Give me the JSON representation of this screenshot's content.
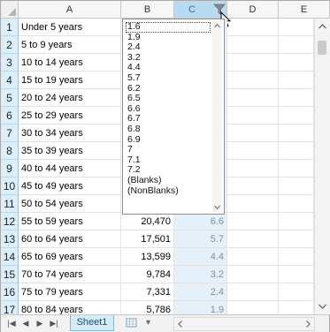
{
  "columns": [
    {
      "label": "A",
      "name": "col-header-a"
    },
    {
      "label": "B",
      "name": "col-header-b"
    },
    {
      "label": "C",
      "name": "col-header-c"
    },
    {
      "label": "D",
      "name": "col-header-d"
    },
    {
      "label": "E",
      "name": "col-header-e"
    }
  ],
  "rows": [
    {
      "num": "1",
      "a": "Under 5 years",
      "b": "",
      "c": ""
    },
    {
      "num": "2",
      "a": "5 to 9 years",
      "b": "",
      "c": ""
    },
    {
      "num": "3",
      "a": "10 to 14 years",
      "b": "",
      "c": ""
    },
    {
      "num": "4",
      "a": "15 to 19 years",
      "b": "",
      "c": ""
    },
    {
      "num": "5",
      "a": "20 to 24 years",
      "b": "",
      "c": ""
    },
    {
      "num": "6",
      "a": "25 to 29 years",
      "b": "",
      "c": ""
    },
    {
      "num": "7",
      "a": "30 to 34 years",
      "b": "",
      "c": ""
    },
    {
      "num": "8",
      "a": "35 to 39 years",
      "b": "",
      "c": ""
    },
    {
      "num": "9",
      "a": "40 to 44 years",
      "b": "",
      "c": ""
    },
    {
      "num": "10",
      "a": "45 to 49 years",
      "b": "",
      "c": ""
    },
    {
      "num": "11",
      "a": "50 to 54 years",
      "b": "",
      "c": ""
    },
    {
      "num": "12",
      "a": "55 to 59 years",
      "b": "20,470",
      "c": "6.6"
    },
    {
      "num": "13",
      "a": "60 to 64 years",
      "b": "17,501",
      "c": "5.7"
    },
    {
      "num": "14",
      "a": "65 to 69 years",
      "b": "13,599",
      "c": "4.4"
    },
    {
      "num": "15",
      "a": "70 to 74 years",
      "b": "9,784",
      "c": "3.2"
    },
    {
      "num": "16",
      "a": "75 to 79 years",
      "b": "7,331",
      "c": "2.4"
    },
    {
      "num": "17",
      "a": "80 to 84 years",
      "b": "5,786",
      "c": "1.9"
    }
  ],
  "filter_dropdown": {
    "items": [
      "1.6",
      "1.9",
      "2.4",
      "3.2",
      "4.4",
      "5.7",
      "6.2",
      "6.5",
      "6.6",
      "6.7",
      "6.8",
      "6.9",
      "7",
      "7.1",
      "7.2",
      "(Blanks)",
      "(NonBlanks)"
    ]
  },
  "icons": {
    "filter": "funnel-filter-icon",
    "nav_first": "first-sheet-icon",
    "nav_prev": "previous-sheet-icon",
    "nav_next": "next-sheet-icon",
    "nav_last": "last-sheet-icon",
    "new_sheet": "new-sheet-icon"
  },
  "sheet_tabs": [
    {
      "label": "Sheet1",
      "active": true
    }
  ],
  "colors": {
    "selected_column_header": "#b7dbf3",
    "selected_column_cells": "#e4f1fb",
    "row_header": "#dbeef9"
  }
}
